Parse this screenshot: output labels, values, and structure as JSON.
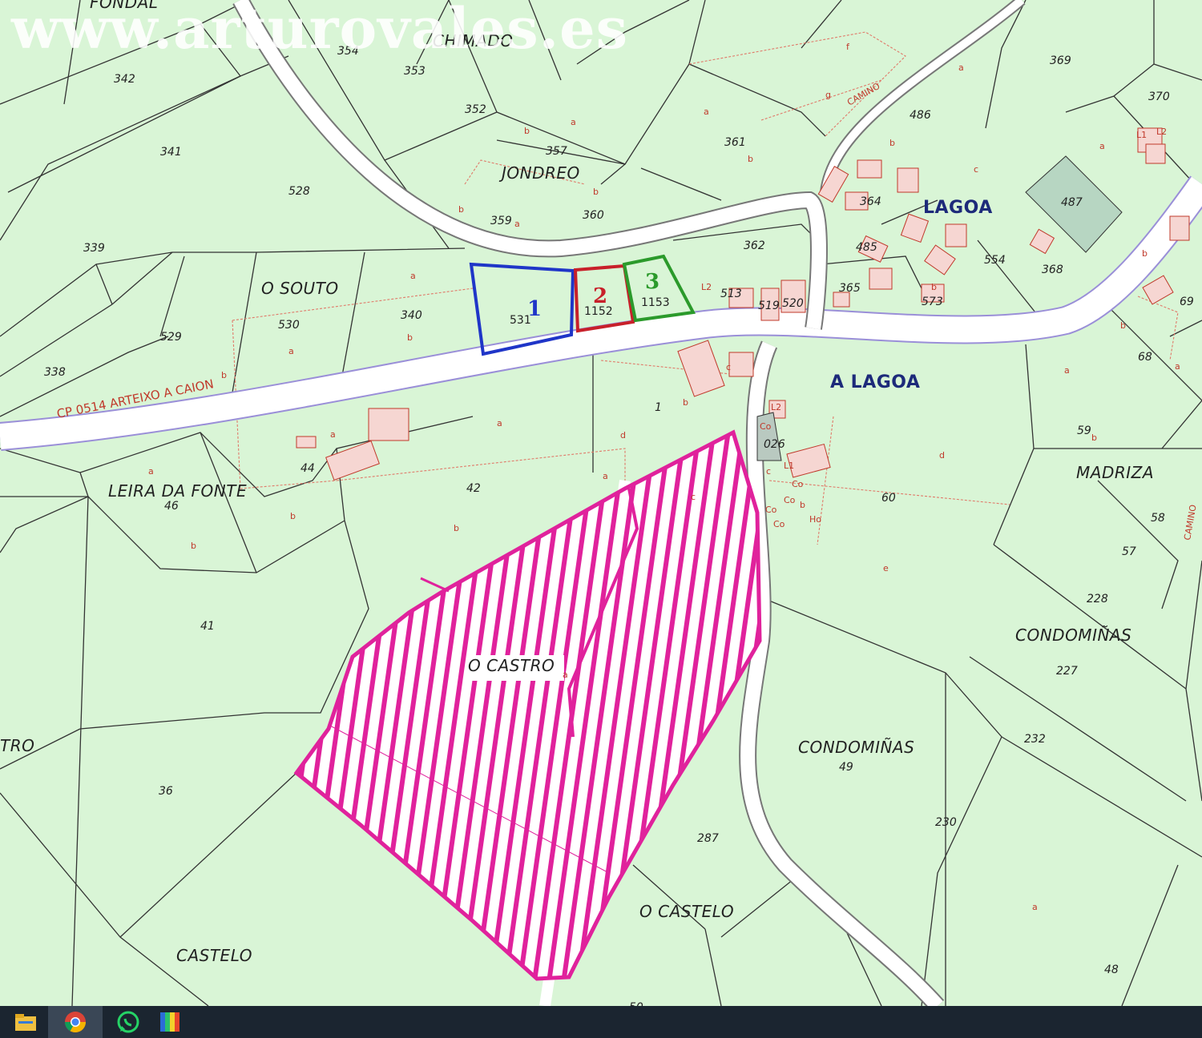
{
  "watermark": "www.arturovales.es",
  "places": {
    "fondal": "FONDAL",
    "chimado": "CHIMADO",
    "jondreo": "JONDREO",
    "lagoa": "LAGOA",
    "a_lagoa": "A LAGOA",
    "o_souto": "O SOUTO",
    "leira_da_fonte": "LEIRA DA FONTE",
    "madriza": "MADRIZA",
    "condominas_1": "CONDOMIÑAS",
    "condominas_2": "CONDOMIÑAS",
    "o_castro": "O CASTRO",
    "o_castelo": "O CASTELO",
    "castelo": "CASTELO",
    "castro_cut": "TRO"
  },
  "road_label": "CP 0514 ARTEIXO A CAION",
  "camino_labels": [
    "CAMINO",
    "CAMINO"
  ],
  "highlighted_plots": [
    {
      "number": "1",
      "ref": "531",
      "color": "#1f35c8"
    },
    {
      "number": "2",
      "ref": "1152",
      "color": "#c8202a"
    },
    {
      "number": "3",
      "ref": "1153",
      "color": "#2b9a2b"
    }
  ],
  "parcel_numbers": [
    "342",
    "341",
    "339",
    "338",
    "528",
    "529",
    "530",
    "340",
    "354",
    "353",
    "352",
    "357",
    "359",
    "360",
    "361",
    "362",
    "364",
    "365",
    "369",
    "370",
    "485",
    "486",
    "487",
    "554",
    "368",
    "573",
    "519",
    "520",
    "513",
    "44",
    "42",
    "41",
    "46",
    "36",
    "1",
    "026",
    "59",
    "58",
    "57",
    "60",
    "68",
    "69",
    "228",
    "227",
    "232",
    "230",
    "49",
    "287",
    "48",
    "50"
  ],
  "sub_letters": [
    "a",
    "b",
    "c",
    "d",
    "e",
    "f",
    "g",
    "L1",
    "L2",
    "Co",
    "Ho"
  ],
  "colors": {
    "map_background": "#d9f5d6",
    "hatch_area": "#e0229c",
    "cadastral_line": "#333333",
    "subparcel_line": "#e07a6a",
    "road": "#ffffff",
    "road_edge": "#9a8fd8"
  },
  "taskbar": {
    "icons": [
      "file-explorer-icon",
      "chrome-icon",
      "whatsapp-icon",
      "color-app-icon"
    ]
  }
}
